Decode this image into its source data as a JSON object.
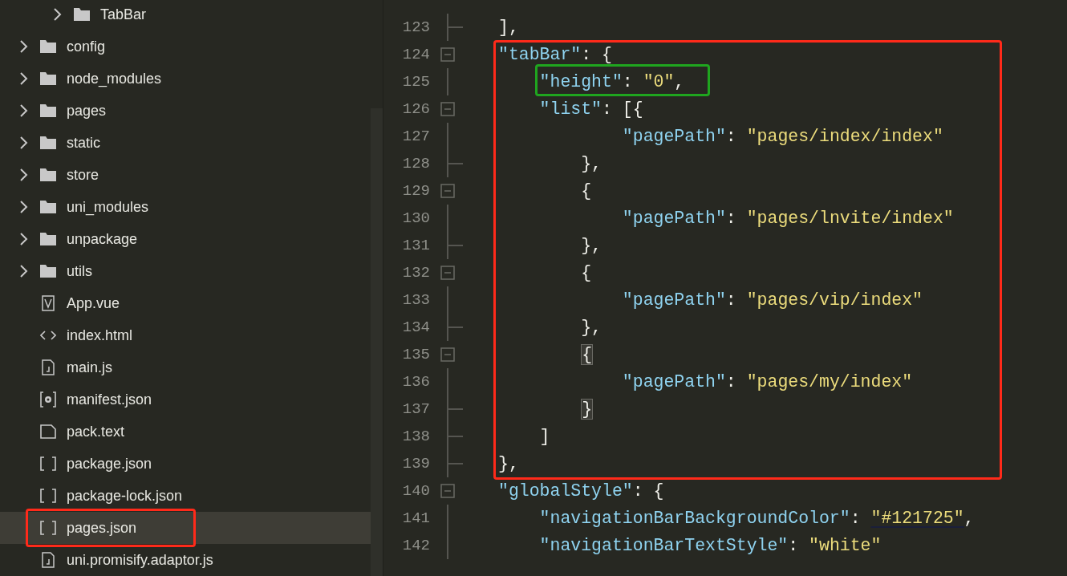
{
  "sidebar": {
    "nested_items": [
      {
        "label": "TabBar",
        "kind": "folder",
        "expanded": false
      }
    ],
    "items": [
      {
        "label": "config",
        "kind": "folder",
        "expanded": false,
        "selected": false
      },
      {
        "label": "node_modules",
        "kind": "folder",
        "expanded": false,
        "selected": false
      },
      {
        "label": "pages",
        "kind": "folder",
        "expanded": false,
        "selected": false
      },
      {
        "label": "static",
        "kind": "folder",
        "expanded": false,
        "selected": false
      },
      {
        "label": "store",
        "kind": "folder",
        "expanded": false,
        "selected": false
      },
      {
        "label": "uni_modules",
        "kind": "folder",
        "expanded": false,
        "selected": false
      },
      {
        "label": "unpackage",
        "kind": "folder",
        "expanded": false,
        "selected": false
      },
      {
        "label": "utils",
        "kind": "folder",
        "expanded": false,
        "selected": false
      },
      {
        "label": "App.vue",
        "kind": "vue",
        "selected": false
      },
      {
        "label": "index.html",
        "kind": "html",
        "selected": false
      },
      {
        "label": "main.js",
        "kind": "js",
        "selected": false
      },
      {
        "label": "manifest.json",
        "kind": "settings",
        "selected": false
      },
      {
        "label": "pack.text",
        "kind": "blank",
        "selected": false
      },
      {
        "label": "package.json",
        "kind": "brackets",
        "selected": false
      },
      {
        "label": "package-lock.json",
        "kind": "brackets",
        "selected": false
      },
      {
        "label": "pages.json",
        "kind": "brackets",
        "selected": true,
        "outlined": true
      },
      {
        "label": "uni.promisify.adaptor.js",
        "kind": "js",
        "selected": false
      }
    ]
  },
  "editor": {
    "frames": [
      {
        "color": "#ff2a1a"
      },
      {
        "color": "#1fa51f"
      }
    ],
    "lines": [
      {
        "number": "123",
        "foldable": false,
        "fold_end": true,
        "tokens": [
          {
            "kind": "plain",
            "text": "],"
          }
        ]
      },
      {
        "number": "124",
        "foldable": true,
        "tokens": [
          {
            "kind": "key",
            "text": "\"tabBar\""
          },
          {
            "kind": "plain",
            "text": ": {"
          }
        ]
      },
      {
        "number": "125",
        "foldable": false,
        "fold_end": false,
        "tokens": [
          {
            "kind": "key",
            "text": "    \"height\""
          },
          {
            "kind": "plain",
            "text": ": "
          },
          {
            "kind": "string",
            "text": "\"0\""
          },
          {
            "kind": "plain",
            "text": ","
          }
        ]
      },
      {
        "number": "126",
        "foldable": true,
        "tokens": [
          {
            "kind": "key",
            "text": "    \"list\""
          },
          {
            "kind": "plain",
            "text": ": [{"
          }
        ]
      },
      {
        "number": "127",
        "foldable": false,
        "fold_end": false,
        "tokens": [
          {
            "kind": "key",
            "text": "            \"pagePath\""
          },
          {
            "kind": "plain",
            "text": ": "
          },
          {
            "kind": "string",
            "text": "\"pages/index/index\""
          }
        ]
      },
      {
        "number": "128",
        "foldable": false,
        "fold_end": true,
        "tokens": [
          {
            "kind": "plain",
            "text": "        },"
          }
        ]
      },
      {
        "number": "129",
        "foldable": true,
        "tokens": [
          {
            "kind": "plain",
            "text": "        {"
          }
        ]
      },
      {
        "number": "130",
        "foldable": false,
        "fold_end": false,
        "tokens": [
          {
            "kind": "key",
            "text": "            \"pagePath\""
          },
          {
            "kind": "plain",
            "text": ": "
          },
          {
            "kind": "string",
            "text": "\"pages/lnvite/index\""
          }
        ]
      },
      {
        "number": "131",
        "foldable": false,
        "fold_end": true,
        "tokens": [
          {
            "kind": "plain",
            "text": "        },"
          }
        ]
      },
      {
        "number": "132",
        "foldable": true,
        "tokens": [
          {
            "kind": "plain",
            "text": "        {"
          }
        ]
      },
      {
        "number": "133",
        "foldable": false,
        "fold_end": false,
        "tokens": [
          {
            "kind": "key",
            "text": "            \"pagePath\""
          },
          {
            "kind": "plain",
            "text": ": "
          },
          {
            "kind": "string",
            "text": "\"pages/vip/index\""
          }
        ]
      },
      {
        "number": "134",
        "foldable": false,
        "fold_end": true,
        "tokens": [
          {
            "kind": "plain",
            "text": "        },"
          }
        ]
      },
      {
        "number": "135",
        "foldable": true,
        "tokens": [
          {
            "kind": "match",
            "text": "        {"
          }
        ]
      },
      {
        "number": "136",
        "foldable": false,
        "fold_end": false,
        "tokens": [
          {
            "kind": "key",
            "text": "            \"pagePath\""
          },
          {
            "kind": "plain",
            "text": ": "
          },
          {
            "kind": "string",
            "text": "\"pages/my/index\""
          }
        ]
      },
      {
        "number": "137",
        "foldable": false,
        "fold_end": true,
        "tokens": [
          {
            "kind": "match",
            "text": "        }"
          }
        ]
      },
      {
        "number": "138",
        "foldable": false,
        "fold_end": true,
        "tokens": [
          {
            "kind": "plain",
            "text": "    ]"
          }
        ]
      },
      {
        "number": "139",
        "foldable": false,
        "fold_end": true,
        "tokens": [
          {
            "kind": "plain",
            "text": "},"
          }
        ]
      },
      {
        "number": "140",
        "foldable": true,
        "tokens": [
          {
            "kind": "key",
            "text": "\"globalStyle\""
          },
          {
            "kind": "plain",
            "text": ": {"
          }
        ]
      },
      {
        "number": "141",
        "foldable": false,
        "fold_end": false,
        "tokens": [
          {
            "kind": "key",
            "text": "    \"navigationBarBackgroundColor\""
          },
          {
            "kind": "plain",
            "text": ": "
          },
          {
            "kind": "string",
            "text": "\"#121725\"",
            "underlined": true
          },
          {
            "kind": "plain",
            "text": ","
          }
        ]
      },
      {
        "number": "142",
        "foldable": false,
        "fold_end": false,
        "tokens": [
          {
            "kind": "key",
            "text": "    \"navigationBarTextStyle\""
          },
          {
            "kind": "plain",
            "text": ": "
          },
          {
            "kind": "string",
            "text": "\"white\""
          }
        ]
      }
    ]
  }
}
